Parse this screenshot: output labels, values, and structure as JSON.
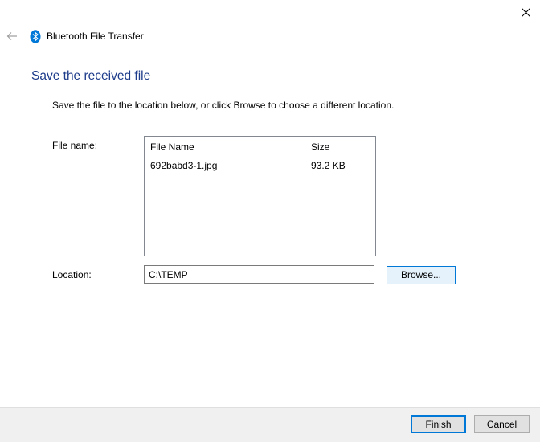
{
  "titlebar": {
    "close_icon": "close-icon"
  },
  "header": {
    "back_icon": "back-arrow-icon",
    "app_icon": "bluetooth-icon",
    "app_title": "Bluetooth File Transfer"
  },
  "main": {
    "heading": "Save the received file",
    "instructions": "Save the file to the location below, or click Browse to choose a different location.",
    "file_name_label": "File name:",
    "file_list": {
      "columns": [
        "File Name",
        "Size"
      ],
      "rows": [
        {
          "name": "692babd3-1.jpg",
          "size": "93.2 KB"
        }
      ]
    },
    "location_label": "Location:",
    "location_value": "C:\\TEMP",
    "browse_label": "Browse..."
  },
  "footer": {
    "finish_label": "Finish",
    "cancel_label": "Cancel"
  },
  "colors": {
    "heading": "#1c3b8a",
    "accent": "#0078d7",
    "footer_bg": "#f0f0f0",
    "button_bg": "#e1e1e1"
  }
}
